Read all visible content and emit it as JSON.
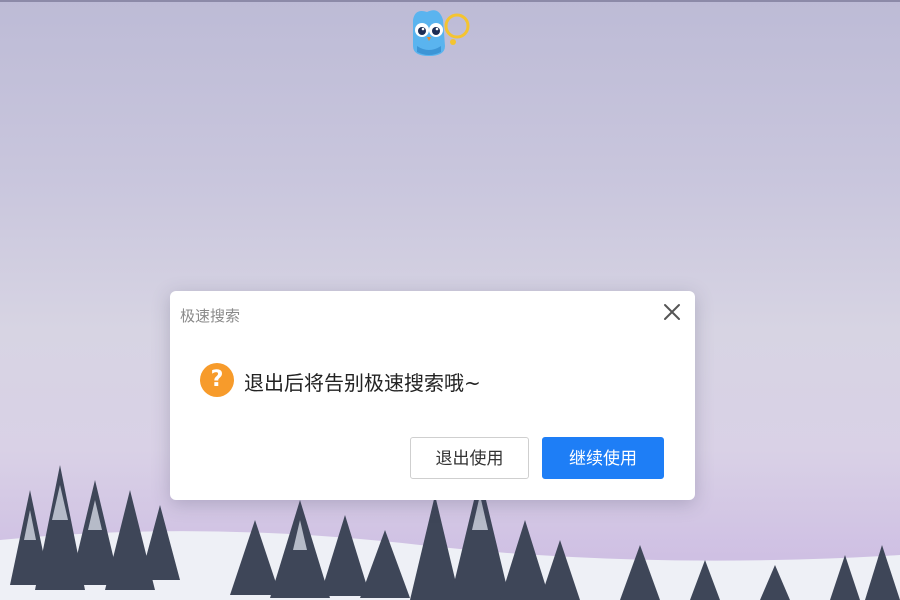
{
  "background": {
    "sky_top": "#bdbbd6",
    "sky_bottom": "#cbb9e2",
    "tree_color": "#3e4658",
    "snow_color": "#eef0f6"
  },
  "mascot": {
    "icon": "owl-mascot-icon"
  },
  "dialog": {
    "title": "极速搜索",
    "close_icon": "close-icon",
    "question_icon": "question-icon",
    "question_mark": "?",
    "message": "退出后将告别极速搜索哦~",
    "exit_button_label": "退出使用",
    "continue_button_label": "继续使用",
    "accent_color": "#1e7ef6",
    "warning_color": "#f79b2b"
  }
}
